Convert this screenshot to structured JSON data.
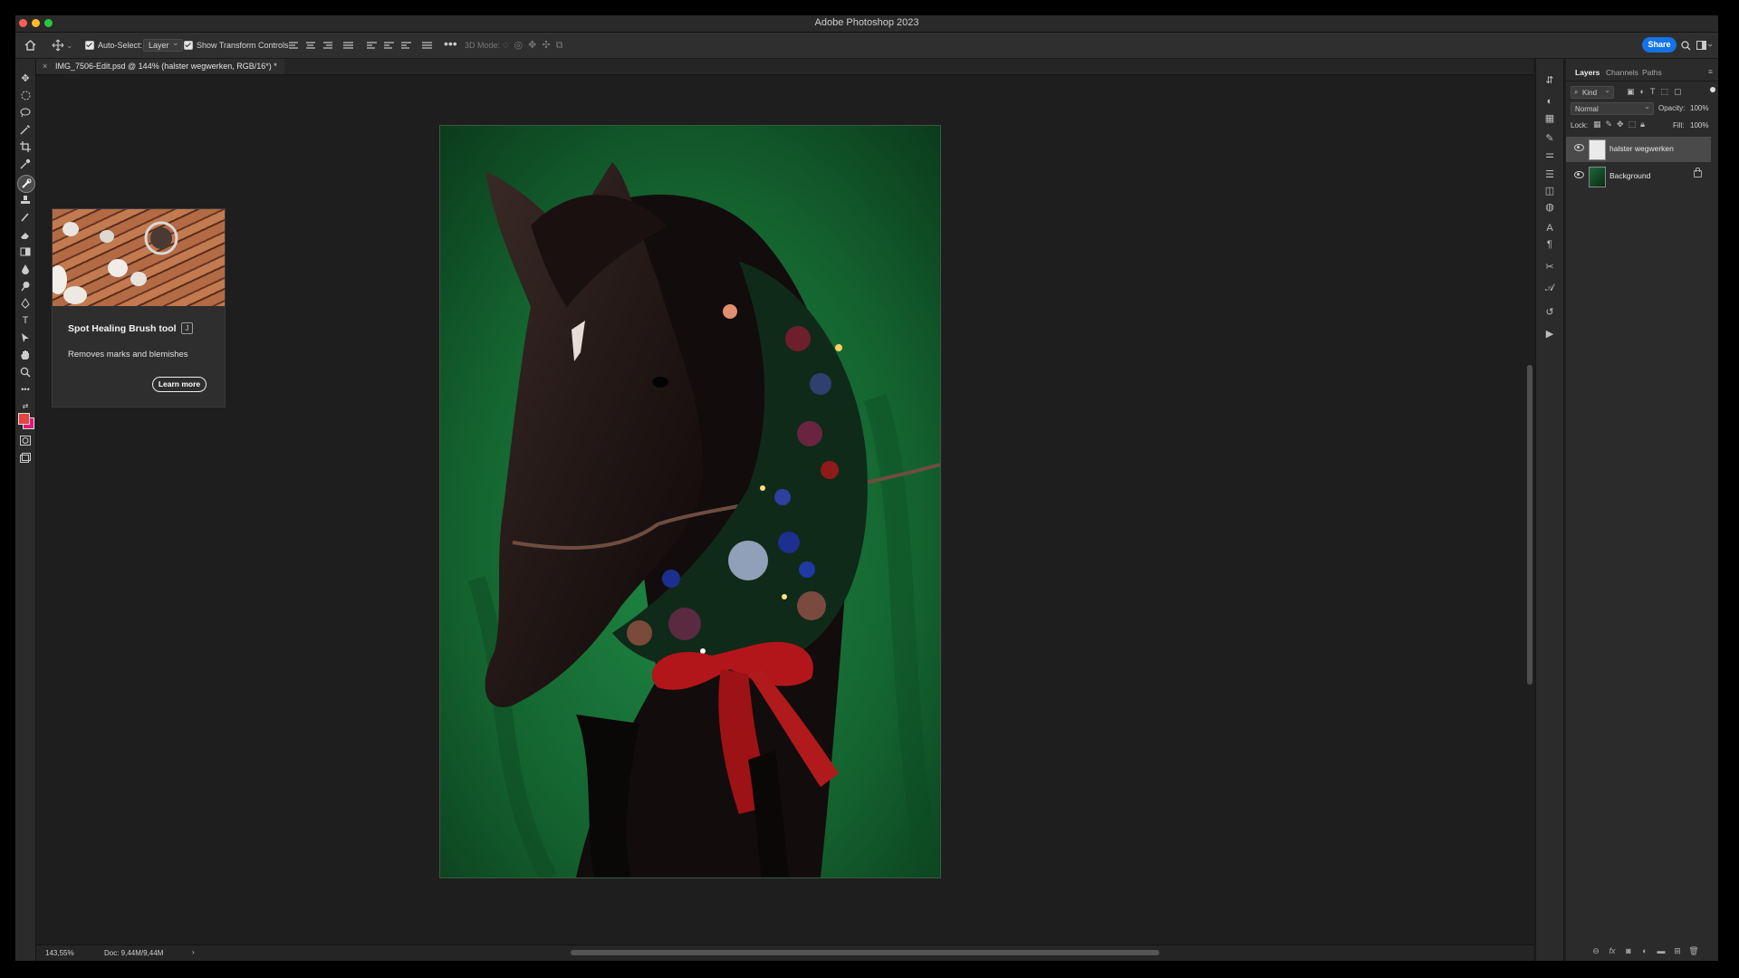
{
  "app": {
    "title": "Adobe Photoshop 2023"
  },
  "options_bar": {
    "auto_select_label": "Auto-Select:",
    "auto_select_value": "Layer",
    "show_transform_label": "Show Transform Controls",
    "mode_3d_label": "3D Mode:",
    "share_label": "Share"
  },
  "document": {
    "tab_title": "IMG_7506-Edit.psd @ 144% (halster wegwerken, RGB/16*) *",
    "close_glyph": "×"
  },
  "status": {
    "zoom": "143,55%",
    "doc_size": "Doc: 9,44M/9,44M",
    "arrow": "›"
  },
  "tooltip": {
    "title": "Spot Healing Brush tool",
    "shortcut": "J",
    "description": "Removes marks and blemishes",
    "button_label": "Learn more"
  },
  "layers_panel": {
    "tabs": [
      "Layers",
      "Channels",
      "Paths"
    ],
    "active_tab": "Layers",
    "kind_label": "Kind",
    "blend_mode": "Normal",
    "opacity_label": "Opacity:",
    "opacity_value": "100%",
    "lock_label": "Lock:",
    "fill_label": "Fill:",
    "fill_value": "100%",
    "layers": [
      {
        "name": "halster wegwerken",
        "selected": true,
        "locked": false
      },
      {
        "name": "Background",
        "selected": false,
        "locked": true
      }
    ]
  },
  "colors": {
    "foreground": "#e8433f",
    "background": "#e0197a",
    "accent": "#1473e6"
  }
}
